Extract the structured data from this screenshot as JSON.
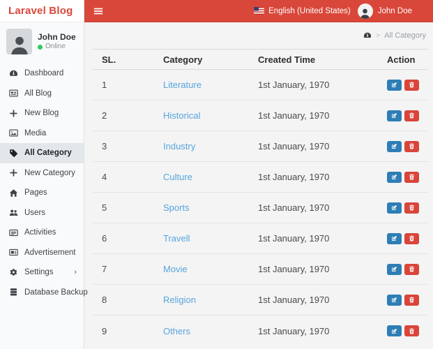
{
  "colors": {
    "header_red": "#d9473a",
    "link_blue": "#56a4da",
    "edit_blue": "#2e7eb5",
    "delete_red": "#d9453a",
    "online_green": "#2fcc5e"
  },
  "brand": {
    "title": "Laravel Blog"
  },
  "topbar": {
    "menu_icon": "hamburger-icon",
    "language": {
      "label": "English (United States)",
      "flag_icon": "us-flag-icon"
    },
    "user": {
      "name": "John Doe",
      "avatar_icon": "person-icon"
    }
  },
  "sidebar": {
    "profile": {
      "name": "John Doe",
      "status": "Online",
      "avatar_icon": "person-icon"
    },
    "items": [
      {
        "label": "Dashboard",
        "icon": "dashboard-icon",
        "active": false,
        "has_submenu": false
      },
      {
        "label": "All Blog",
        "icon": "blog-icon",
        "active": false,
        "has_submenu": false
      },
      {
        "label": "New Blog",
        "icon": "plus-icon",
        "active": false,
        "has_submenu": false
      },
      {
        "label": "Media",
        "icon": "media-icon",
        "active": false,
        "has_submenu": false
      },
      {
        "label": "All Category",
        "icon": "tag-icon",
        "active": true,
        "has_submenu": false
      },
      {
        "label": "New Category",
        "icon": "plus-icon",
        "active": false,
        "has_submenu": false
      },
      {
        "label": "Pages",
        "icon": "home-icon",
        "active": false,
        "has_submenu": false
      },
      {
        "label": "Users",
        "icon": "users-icon",
        "active": false,
        "has_submenu": false
      },
      {
        "label": "Activities",
        "icon": "activities-icon",
        "active": false,
        "has_submenu": false
      },
      {
        "label": "Advertisement",
        "icon": "ad-icon",
        "active": false,
        "has_submenu": false
      },
      {
        "label": "Settings",
        "icon": "settings-icon",
        "active": false,
        "has_submenu": true
      },
      {
        "label": "Database Backup",
        "icon": "database-icon",
        "active": false,
        "has_submenu": false
      }
    ],
    "submenu_arrow": "›"
  },
  "breadcrumb": {
    "home_icon": "dashboard-icon",
    "separator": ">",
    "current": "All Category"
  },
  "table": {
    "headers": [
      "SL.",
      "Category",
      "Created Time",
      "Action"
    ],
    "actions": {
      "edit_icon": "edit-icon",
      "delete_icon": "trash-icon"
    },
    "rows": [
      {
        "sl": "1",
        "category": "Literature",
        "created": "1st January, 1970"
      },
      {
        "sl": "2",
        "category": "Historical",
        "created": "1st January, 1970"
      },
      {
        "sl": "3",
        "category": "Industry",
        "created": "1st January, 1970"
      },
      {
        "sl": "4",
        "category": "Culture",
        "created": "1st January, 1970"
      },
      {
        "sl": "5",
        "category": "Sports",
        "created": "1st January, 1970"
      },
      {
        "sl": "6",
        "category": "Travell",
        "created": "1st January, 1970"
      },
      {
        "sl": "7",
        "category": "Movie",
        "created": "1st January, 1970"
      },
      {
        "sl": "8",
        "category": "Religion",
        "created": "1st January, 1970"
      },
      {
        "sl": "9",
        "category": "Others",
        "created": "1st January, 1970"
      }
    ]
  }
}
